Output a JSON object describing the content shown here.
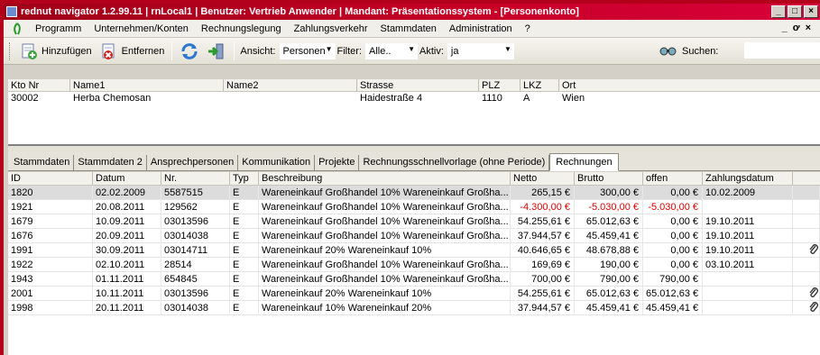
{
  "title": "rednut navigator 1.2.99.11  | rnLocal1  |  Benutzer: Vertrieb Anwender  |  Mandant: Präsentationssystem - [Personenkonto]",
  "window_buttons": [
    "_",
    "□",
    "×"
  ],
  "mdi_buttons": [
    "_",
    "ơ",
    "×"
  ],
  "menu": [
    "Programm",
    "Unternehmen/Konten",
    "Rechnungslegung",
    "Zahlungsverkehr",
    "Stammdaten",
    "Administration",
    "?"
  ],
  "toolbar": {
    "add_label": "Hinzufügen",
    "remove_label": "Entfernen",
    "view_label": "Ansicht:",
    "view_value": "Personen",
    "filter_label": "Filter:",
    "filter_value": "Alle..",
    "active_label": "Aktiv:",
    "active_value": "ja",
    "search_label": "Suchen:"
  },
  "accounts": {
    "columns": [
      "Kto Nr",
      "Name1",
      "Name2",
      "Strasse",
      "PLZ",
      "LKZ",
      "Ort"
    ],
    "rows": [
      [
        "30002",
        "Herba Chemosan",
        "",
        "Haidestraße 4",
        "1110",
        "A",
        "Wien"
      ]
    ]
  },
  "tabs": [
    "Stammdaten",
    "Stammdaten 2",
    "Ansprechpersonen",
    "Kommunikation",
    "Projekte",
    "Rechnungsschnellvorlage (ohne Periode)",
    "Rechnungen"
  ],
  "active_tab": "Rechnungen",
  "invoices": {
    "columns": [
      "ID",
      "Datum",
      "Nr.",
      "Typ",
      "Beschreibung",
      "Netto",
      "Brutto",
      "offen",
      "Zahlungsdatum",
      ""
    ],
    "rows": [
      {
        "id": "1820",
        "datum": "02.02.2009",
        "nr": "5587515",
        "typ": "E",
        "beschreibung": "Wareneinkauf Großhandel 10%  Wareneinkauf Großha...",
        "netto": "265,15 €",
        "brutto": "300,00 €",
        "offen": "0,00 €",
        "zahlungsdatum": "10.02.2009",
        "attach": false,
        "neg": false
      },
      {
        "id": "1921",
        "datum": "20.08.2011",
        "nr": "129562",
        "typ": "E",
        "beschreibung": "Wareneinkauf Großhandel 10%  Wareneinkauf Großha...",
        "netto": "-4.300,00 €",
        "brutto": "-5.030,00 €",
        "offen": "-5.030,00 €",
        "zahlungsdatum": "",
        "attach": false,
        "neg": true
      },
      {
        "id": "1679",
        "datum": "10.09.2011",
        "nr": "03013596",
        "typ": "E",
        "beschreibung": "Wareneinkauf Großhandel 10%  Wareneinkauf Großha...",
        "netto": "54.255,61 €",
        "brutto": "65.012,63 €",
        "offen": "0,00 €",
        "zahlungsdatum": "19.10.2011",
        "attach": false,
        "neg": false
      },
      {
        "id": "1676",
        "datum": "20.09.2011",
        "nr": "03014038",
        "typ": "E",
        "beschreibung": "Wareneinkauf Großhandel 10%  Wareneinkauf Großha...",
        "netto": "37.944,57 €",
        "brutto": "45.459,41 €",
        "offen": "0,00 €",
        "zahlungsdatum": "19.10.2011",
        "attach": false,
        "neg": false
      },
      {
        "id": "1991",
        "datum": "30.09.2011",
        "nr": "03014711",
        "typ": "E",
        "beschreibung": "Wareneinkauf 20%  Wareneinkauf 10%",
        "netto": "40.646,65 €",
        "brutto": "48.678,88 €",
        "offen": "0,00 €",
        "zahlungsdatum": "19.10.2011",
        "attach": true,
        "neg": false
      },
      {
        "id": "1922",
        "datum": "02.10.2011",
        "nr": "28514",
        "typ": "E",
        "beschreibung": "Wareneinkauf Großhandel 10%  Wareneinkauf Großha...",
        "netto": "169,69 €",
        "brutto": "190,00 €",
        "offen": "0,00 €",
        "zahlungsdatum": "03.10.2011",
        "attach": false,
        "neg": false
      },
      {
        "id": "1943",
        "datum": "01.11.2011",
        "nr": "654845",
        "typ": "E",
        "beschreibung": "Wareneinkauf Großhandel 10%  Wareneinkauf Großha...",
        "netto": "700,00 €",
        "brutto": "790,00 €",
        "offen": "790,00 €",
        "zahlungsdatum": "",
        "attach": false,
        "neg": false
      },
      {
        "id": "2001",
        "datum": "10.11.2011",
        "nr": "03013596",
        "typ": "E",
        "beschreibung": "Wareneinkauf 20%  Wareneinkauf 10%",
        "netto": "54.255,61 €",
        "brutto": "65.012,63 €",
        "offen": "65.012,63 €",
        "zahlungsdatum": "",
        "attach": true,
        "neg": false
      },
      {
        "id": "1998",
        "datum": "20.11.2011",
        "nr": "03014038",
        "typ": "E",
        "beschreibung": "Wareneinkauf 10%  Wareneinkauf 20%",
        "netto": "37.944,57 €",
        "brutto": "45.459,41 €",
        "offen": "45.459,41 €",
        "zahlungsdatum": "",
        "attach": true,
        "neg": false
      }
    ]
  },
  "colors": {
    "title_bar": "#c00020",
    "negative": "#e00000",
    "frame": "#b3001b"
  }
}
